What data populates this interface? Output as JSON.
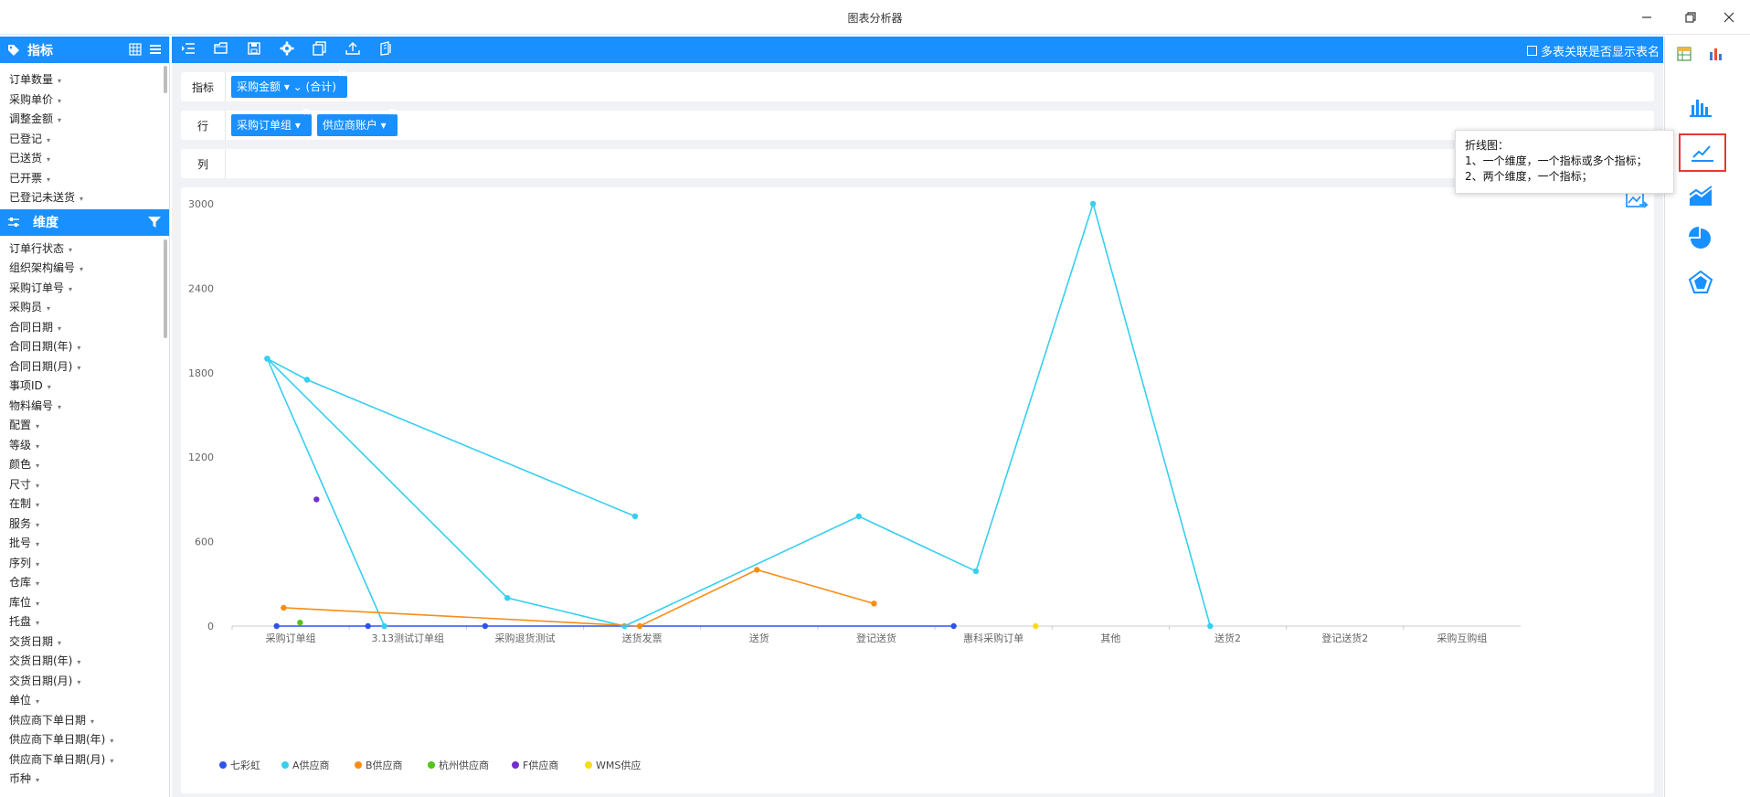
{
  "window": {
    "title": "图表分析器"
  },
  "left": {
    "metrics_title": "指标",
    "metrics": [
      "订单数量",
      "采购单价",
      "调整金额",
      "已登记",
      "已送货",
      "已开票",
      "已登记未送货"
    ],
    "dimensions_title": "维度",
    "dimensions": [
      "订单行状态",
      "组织架构编号",
      "采购订单号",
      "采购员",
      "合同日期",
      "合同日期(年)",
      "合同日期(月)",
      "事项ID",
      "物料编号",
      "配置",
      "等级",
      "颜色",
      "尺寸",
      "在制",
      "服务",
      "批号",
      "序列",
      "仓库",
      "库位",
      "托盘",
      "交货日期",
      "交货日期(年)",
      "交货日期(月)",
      "单位",
      "供应商下单日期",
      "供应商下单日期(年)",
      "供应商下单日期(月)",
      "币种"
    ]
  },
  "toolbar": {
    "multi_table_label": "多表关联是否显示表名"
  },
  "shelves": {
    "metric_label": "指标",
    "metric_pills": [
      "采购金额 ▾ ⌄ (合计)"
    ],
    "row_label": "行",
    "row_pills": [
      "采购订单组 ▾",
      "供应商账户 ▾"
    ],
    "col_label": "列"
  },
  "tooltip": {
    "line1": "折线图：",
    "line2": "1、一个维度，一个指标或多个指标；",
    "line3": "2、两个维度，一个指标；"
  },
  "icons": {
    "right_top": [
      "table-icon",
      "bar-chart-icon"
    ],
    "chart_types": [
      "bar-chart-icon",
      "line-chart-icon",
      "area-chart-icon",
      "pie-chart-icon",
      "radar-chart-icon"
    ],
    "selected_chart_type": "line-chart-icon"
  },
  "chart_data": {
    "type": "line",
    "categories": [
      "采购订单组",
      "3.13测试订单组",
      "采购退货测试",
      "送货发票",
      "送货",
      "登记送货",
      "惠科采购订单",
      "其他",
      "送货2",
      "登记送货2",
      "采购互购组"
    ],
    "yticks": [
      0,
      600,
      1200,
      1800,
      2400,
      3000
    ],
    "ylim": [
      0,
      3000
    ],
    "legend_position": "bottom-left",
    "series": [
      {
        "name": "七彩虹",
        "color": "#2f54eb",
        "points": [
          [
            -0.12,
            0
          ],
          [
            0.66,
            0
          ],
          [
            1.66,
            0
          ],
          [
            5.66,
            0
          ]
        ]
      },
      {
        "name": "A供应商",
        "color": "#36cfef",
        "points": [
          [
            -0.2,
            1900
          ],
          [
            0.14,
            1750
          ],
          [
            2.94,
            780
          ]
        ]
      },
      {
        "name": "A供应商",
        "color": "#36cfef",
        "points": [
          [
            -0.2,
            1900
          ],
          [
            0.8,
            0
          ]
        ]
      },
      {
        "name": "A供应商",
        "color": "#36cfef",
        "points": [
          [
            -0.2,
            1900
          ],
          [
            1.85,
            200
          ],
          [
            2.85,
            0
          ],
          [
            4.85,
            780
          ],
          [
            5.85,
            390
          ],
          [
            6.85,
            3000
          ],
          [
            7.85,
            0
          ]
        ]
      },
      {
        "name": "B供应商",
        "color": "#fa8c16",
        "points": [
          [
            -0.06,
            130
          ],
          [
            2.98,
            0
          ],
          [
            3.98,
            400
          ],
          [
            4.98,
            160
          ]
        ]
      },
      {
        "name": "杭州供应商",
        "color": "#52c41a",
        "points": [
          [
            0.08,
            25
          ]
        ]
      },
      {
        "name": "F供应商",
        "color": "#722ed1",
        "points": [
          [
            0.22,
            900
          ]
        ]
      },
      {
        "name": "WMS供应",
        "color": "#fadb14",
        "points": [
          [
            6.36,
            0
          ]
        ]
      }
    ],
    "legend": [
      "七彩虹",
      "A供应商",
      "B供应商",
      "杭州供应商",
      "F供应商",
      "WMS供应"
    ]
  }
}
